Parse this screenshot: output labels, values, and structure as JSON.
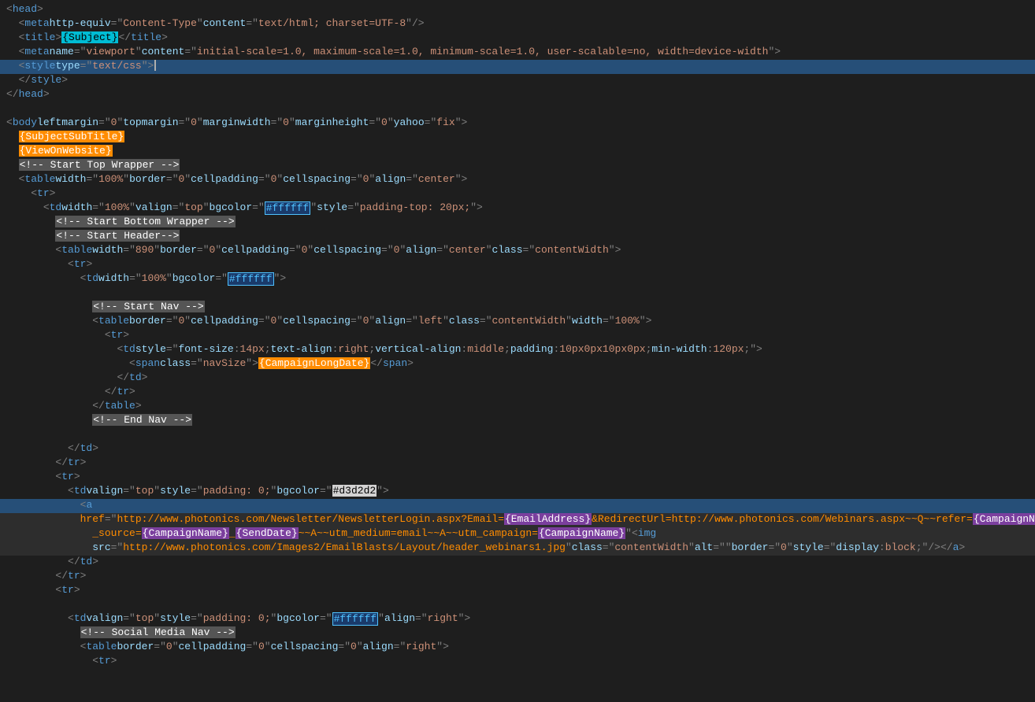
{
  "lines": [
    {
      "id": 1,
      "content": "head_open",
      "indent": 0
    },
    {
      "id": 2,
      "content": "meta_content_type",
      "indent": 1
    },
    {
      "id": 3,
      "content": "title_subject",
      "indent": 1
    },
    {
      "id": 4,
      "content": "meta_viewport",
      "indent": 1
    },
    {
      "id": 5,
      "content": "style_open",
      "indent": 1,
      "selected": true
    },
    {
      "id": 6,
      "content": "style_close",
      "indent": 1
    },
    {
      "id": 7,
      "content": "head_close",
      "indent": 0
    },
    {
      "id": 8,
      "content": "blank"
    },
    {
      "id": 9,
      "content": "body_open",
      "indent": 0
    },
    {
      "id": 10,
      "content": "subject_subtitle",
      "indent": 1
    },
    {
      "id": 11,
      "content": "view_on_website",
      "indent": 1
    },
    {
      "id": 12,
      "content": "comment_start_top_wrapper",
      "indent": 1
    },
    {
      "id": 13,
      "content": "table_top",
      "indent": 1
    },
    {
      "id": 14,
      "content": "tr_open",
      "indent": 2
    },
    {
      "id": 15,
      "content": "td_top",
      "indent": 3
    },
    {
      "id": 16,
      "content": "comment_start_bottom_wrapper",
      "indent": 4
    },
    {
      "id": 17,
      "content": "comment_start_header",
      "indent": 4
    },
    {
      "id": 18,
      "content": "table_890",
      "indent": 4
    },
    {
      "id": 19,
      "content": "tr_open2",
      "indent": 5
    },
    {
      "id": 20,
      "content": "td_bgcolor",
      "indent": 6
    },
    {
      "id": 21,
      "content": "blank2"
    },
    {
      "id": 22,
      "content": "comment_start_nav",
      "indent": 7
    },
    {
      "id": 23,
      "content": "table_nav",
      "indent": 7
    },
    {
      "id": 24,
      "content": "tr_open3",
      "indent": 8
    },
    {
      "id": 25,
      "content": "td_style",
      "indent": 9
    },
    {
      "id": 26,
      "content": "span_nav",
      "indent": 10
    },
    {
      "id": 27,
      "content": "td_close",
      "indent": 9
    },
    {
      "id": 28,
      "content": "tr_close",
      "indent": 8
    },
    {
      "id": 29,
      "content": "table_close",
      "indent": 7
    },
    {
      "id": 30,
      "content": "comment_end_nav",
      "indent": 7
    },
    {
      "id": 31,
      "content": "blank3"
    },
    {
      "id": 32,
      "content": "td_close2",
      "indent": 4
    },
    {
      "id": 33,
      "content": "tr_close2",
      "indent": 3
    },
    {
      "id": 34,
      "content": "tr_open4",
      "indent": 3
    },
    {
      "id": 35,
      "content": "td_d3d2d2",
      "indent": 4
    },
    {
      "id": 36,
      "content": "a_open",
      "indent": 5,
      "highlight": true
    },
    {
      "id": 37,
      "content": "href_line",
      "indent": 5,
      "gray": true
    },
    {
      "id": 38,
      "content": "source_line",
      "indent": 6,
      "gray": true
    },
    {
      "id": 39,
      "content": "img_src",
      "indent": 6,
      "gray": true
    },
    {
      "id": 40,
      "content": "td_close3",
      "indent": 5
    },
    {
      "id": 41,
      "content": "tr_close3",
      "indent": 4
    },
    {
      "id": 42,
      "content": "tr_open5",
      "indent": 4
    },
    {
      "id": 43,
      "content": "blank4"
    },
    {
      "id": 44,
      "content": "td_social",
      "indent": 5
    },
    {
      "id": 45,
      "content": "comment_social_nav",
      "indent": 6
    },
    {
      "id": 46,
      "content": "table_social",
      "indent": 6
    },
    {
      "id": 47,
      "content": "tr_open6",
      "indent": 7
    }
  ],
  "colors": {
    "bg": "#1e1e1e",
    "tag": "#569cd6",
    "attr": "#9cdcfe",
    "string": "#ce9178",
    "comment": "#608b4e",
    "template": "#ff79c6",
    "number": "#b5cea8",
    "selected_bg": "#264f78"
  }
}
